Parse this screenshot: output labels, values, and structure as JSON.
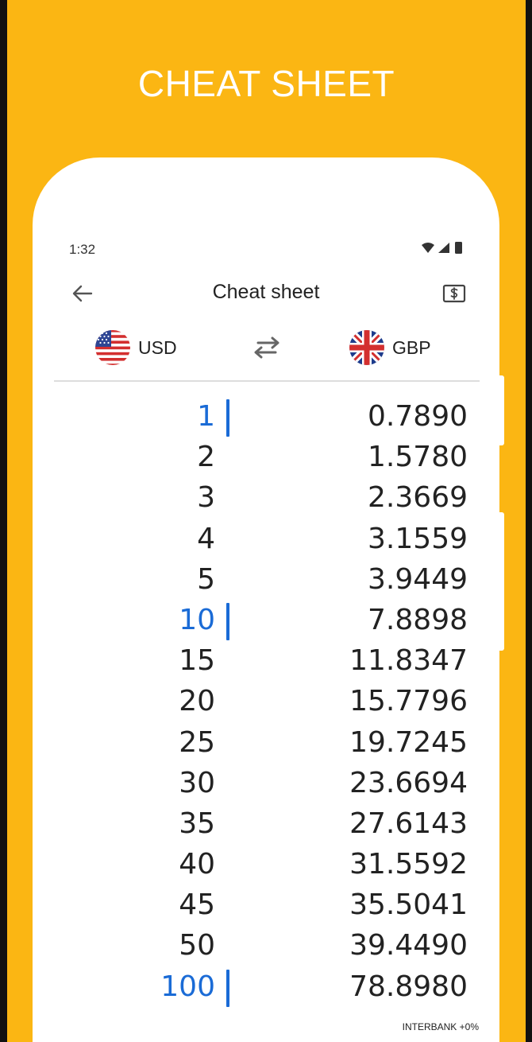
{
  "banner": {
    "title": "CHEAT SHEET"
  },
  "status_bar": {
    "time": "1:32"
  },
  "appbar": {
    "title": "Cheat sheet"
  },
  "currencies": {
    "from": {
      "code": "USD",
      "flag": "us-flag-icon"
    },
    "to": {
      "code": "GBP",
      "flag": "uk-flag-icon"
    }
  },
  "rows": [
    {
      "amount": "1",
      "value": "0.7890",
      "highlight": true
    },
    {
      "amount": "2",
      "value": "1.5780",
      "highlight": false
    },
    {
      "amount": "3",
      "value": "2.3669",
      "highlight": false
    },
    {
      "amount": "4",
      "value": "3.1559",
      "highlight": false
    },
    {
      "amount": "5",
      "value": "3.9449",
      "highlight": false
    },
    {
      "amount": "10",
      "value": "7.8898",
      "highlight": true
    },
    {
      "amount": "15",
      "value": "11.8347",
      "highlight": false
    },
    {
      "amount": "20",
      "value": "15.7796",
      "highlight": false
    },
    {
      "amount": "25",
      "value": "19.7245",
      "highlight": false
    },
    {
      "amount": "30",
      "value": "23.6694",
      "highlight": false
    },
    {
      "amount": "35",
      "value": "27.6143",
      "highlight": false
    },
    {
      "amount": "40",
      "value": "31.5592",
      "highlight": false
    },
    {
      "amount": "45",
      "value": "35.5041",
      "highlight": false
    },
    {
      "amount": "50",
      "value": "39.4490",
      "highlight": false
    },
    {
      "amount": "100",
      "value": "78.8980",
      "highlight": true
    }
  ],
  "footer": {
    "rate_note": "INTERBANK +0%"
  },
  "colors": {
    "banner_bg": "#FBB613",
    "accent": "#1A6BD6",
    "text": "#222222"
  }
}
